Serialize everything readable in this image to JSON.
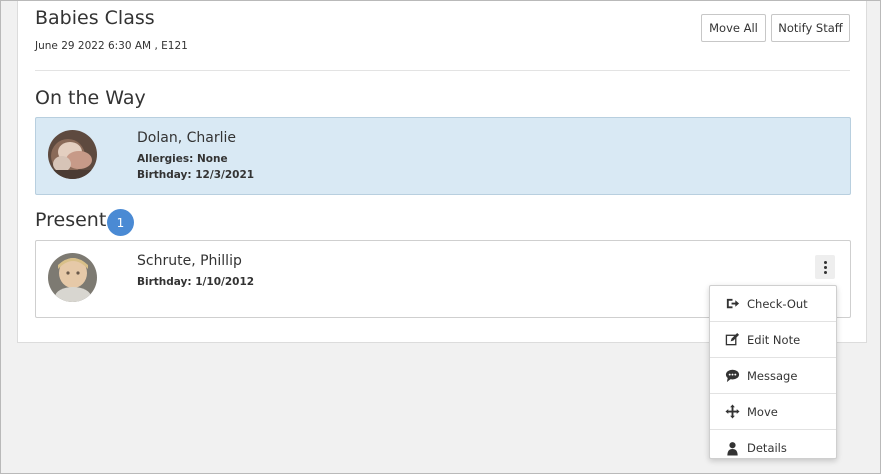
{
  "header": {
    "class_name": "Babies Class",
    "subtitle": "June 29 2022 6:30 AM , E121",
    "move_all_label": "Move All",
    "notify_staff_label": "Notify Staff"
  },
  "on_the_way": {
    "title": "On the Way",
    "children": [
      {
        "name": "Dolan, Charlie",
        "allergies": "Allergies: None",
        "birthday": "Birthday: 12/3/2021"
      }
    ]
  },
  "present": {
    "title": "Present",
    "count": "1",
    "children": [
      {
        "name": "Schrute, Phillip",
        "birthday": "Birthday: 1/10/2012"
      }
    ]
  },
  "actions_menu": {
    "items": [
      {
        "label": "Check-Out",
        "icon": "check-out-icon"
      },
      {
        "label": "Edit Note",
        "icon": "edit-note-icon"
      },
      {
        "label": "Message",
        "icon": "message-icon"
      },
      {
        "label": "Move",
        "icon": "move-icon"
      },
      {
        "label": "Details",
        "icon": "person-icon"
      }
    ]
  },
  "colors": {
    "accent_badge": "#4a8ad4",
    "on_the_way_card_bg": "#d9e9f4",
    "page_bg": "#f1f1f1"
  }
}
